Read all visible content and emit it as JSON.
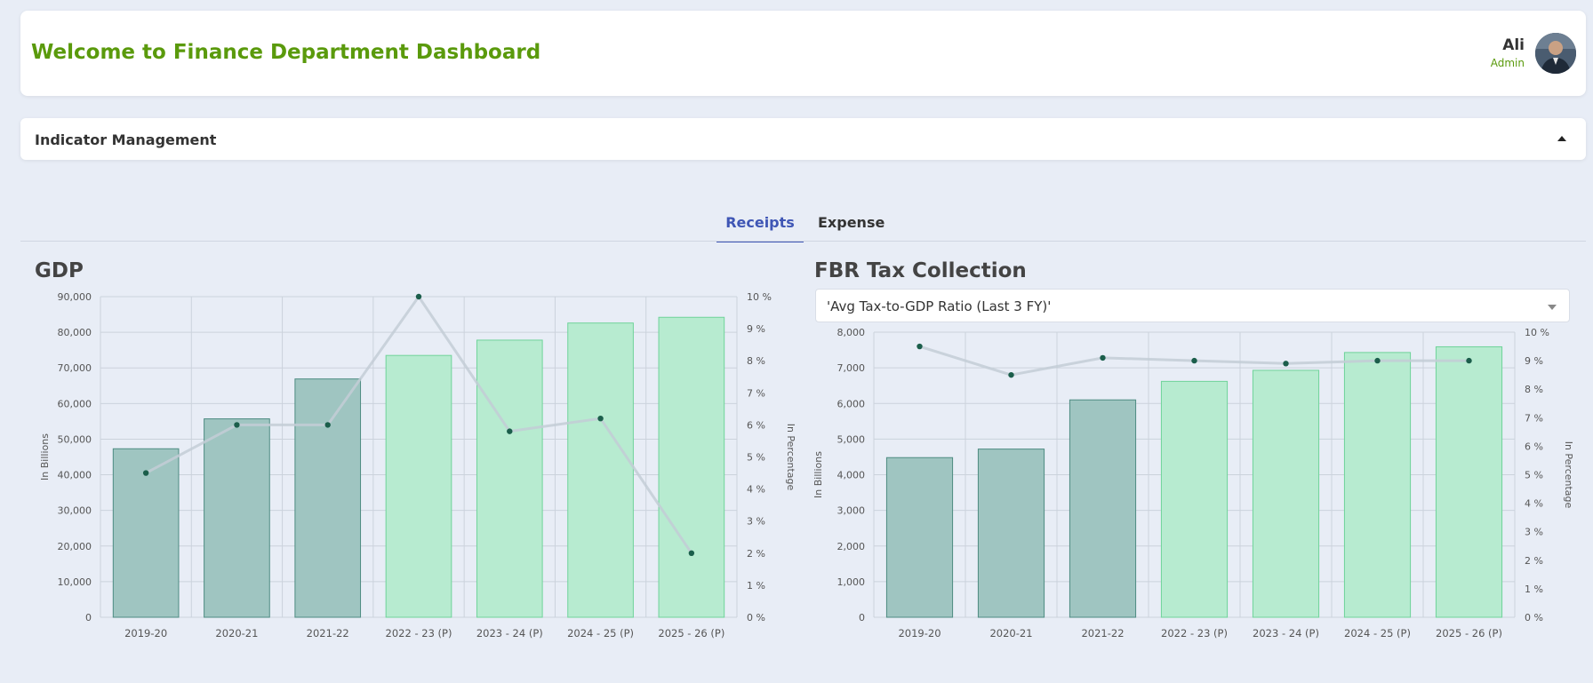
{
  "header": {
    "title": "Welcome to Finance Department Dashboard",
    "user_name": "Ali",
    "user_role": "Admin",
    "accent_color": "#5a9a0c"
  },
  "indicator": {
    "title": "Indicator Management",
    "icon": "caret-up-icon"
  },
  "tabs": [
    {
      "label": "Receipts",
      "active": true
    },
    {
      "label": "Expense",
      "active": false
    }
  ],
  "gdp_chart": {
    "title": "GDP"
  },
  "fbr_chart": {
    "title": "FBR Tax Collection",
    "dropdown_value": "'Avg Tax-to-GDP Ratio (Last 3 FY)'"
  },
  "chart_data": [
    {
      "type": "bar",
      "title": "GDP",
      "categories": [
        "2019-20",
        "2020-21",
        "2021-22",
        "2022 - 23 (P)",
        "2023 - 24 (P)",
        "2024 - 25 (P)",
        "2025 - 26 (P)"
      ],
      "ylabel": "In Billions",
      "y2label": "In Percentage",
      "ylim": [
        0,
        90000
      ],
      "y2lim": [
        0,
        10
      ],
      "yticks": [
        "0",
        "10,000",
        "20,000",
        "30,000",
        "40,000",
        "50,000",
        "60,000",
        "70,000",
        "80,000",
        "90,000"
      ],
      "y2ticks": [
        "0 %",
        "1 %",
        "2 %",
        "3 %",
        "4 %",
        "5 %",
        "6 %",
        "7 %",
        "8 %",
        "9 %",
        "10 %"
      ],
      "series": [
        {
          "type": "bar",
          "values": [
            47300,
            55700,
            66900,
            73500,
            77800,
            82600,
            84200
          ]
        },
        {
          "type": "line",
          "axis": "right",
          "values": [
            4.5,
            6.0,
            6.0,
            10.0,
            5.8,
            6.2,
            2.0
          ]
        }
      ],
      "bar_colors": [
        "#9fc5c1",
        "#9fc5c1",
        "#9fc5c1",
        "#b7ebd0",
        "#b7ebd0",
        "#b7ebd0",
        "#b7ebd0"
      ],
      "bar_borders": [
        "#4e8c82",
        "#4e8c82",
        "#4e8c82",
        "#6fd39a",
        "#6fd39a",
        "#6fd39a",
        "#6fd39a"
      ],
      "grid": true
    },
    {
      "type": "bar",
      "title": "FBR Tax Collection",
      "categories": [
        "2019-20",
        "2020-21",
        "2021-22",
        "2022 - 23 (P)",
        "2023 - 24 (P)",
        "2024 - 25 (P)",
        "2025 - 26 (P)"
      ],
      "ylabel": "In Billions",
      "y2label": "In Percentage",
      "ylim": [
        0,
        8000
      ],
      "y2lim": [
        0,
        10
      ],
      "yticks": [
        "0",
        "1,000",
        "2,000",
        "3,000",
        "4,000",
        "5,000",
        "6,000",
        "7,000",
        "8,000"
      ],
      "y2ticks": [
        "0 %",
        "1 %",
        "2 %",
        "3 %",
        "4 %",
        "5 %",
        "6 %",
        "7 %",
        "8 %",
        "9 %",
        "10 %"
      ],
      "series": [
        {
          "type": "bar",
          "values": [
            4480,
            4720,
            6100,
            6620,
            6930,
            7430,
            7590
          ]
        },
        {
          "type": "line",
          "axis": "right",
          "values": [
            9.5,
            8.5,
            9.1,
            9.0,
            8.9,
            9.0,
            9.0
          ]
        }
      ],
      "bar_colors": [
        "#9fc5c1",
        "#9fc5c1",
        "#9fc5c1",
        "#b7ebd0",
        "#b7ebd0",
        "#b7ebd0",
        "#b7ebd0"
      ],
      "bar_borders": [
        "#4e8c82",
        "#4e8c82",
        "#4e8c82",
        "#6fd39a",
        "#6fd39a",
        "#6fd39a",
        "#6fd39a"
      ],
      "grid": true
    }
  ]
}
